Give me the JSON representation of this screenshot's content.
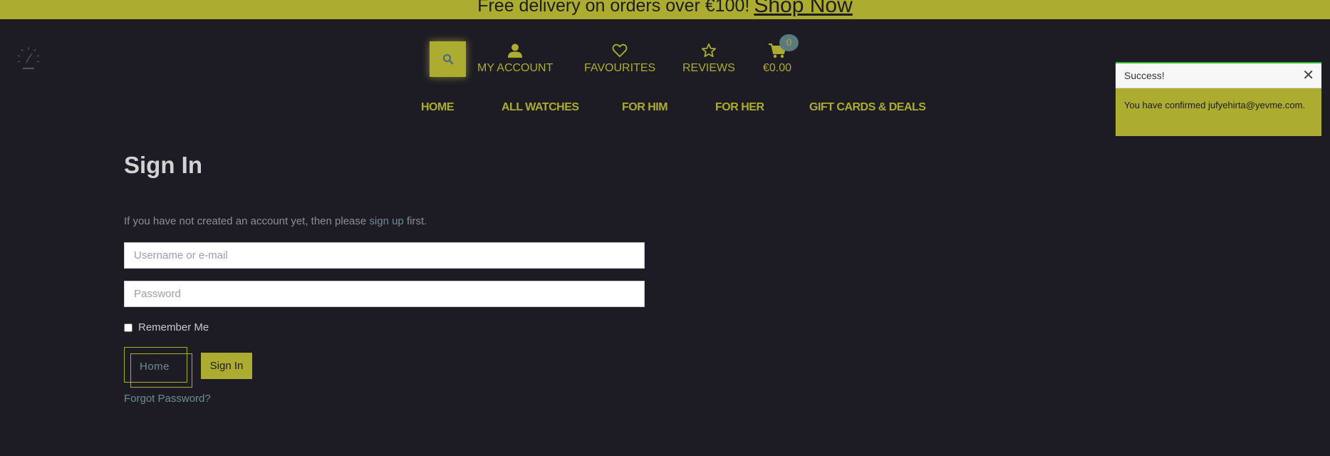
{
  "promo": {
    "text": "Free delivery on orders over €100!",
    "link": "Shop Now"
  },
  "header": {
    "account_label": "MY ACCOUNT",
    "favourites_label": "FAVOURITES",
    "reviews_label": "REVIEWS",
    "cart_total": "€0.00",
    "cart_count": "0",
    "icons": {
      "search": "search-icon",
      "account": "user-icon",
      "favourites": "heart-icon",
      "reviews": "star-icon",
      "cart": "cart-icon"
    }
  },
  "nav": {
    "home": "HOME",
    "all_watches": "ALL WATCHES",
    "for_him": "FOR HIM",
    "for_her": "FOR HER",
    "gift_cards": "GIFT CARDS & DEALS"
  },
  "signin": {
    "title": "Sign In",
    "intro_before": "If you have not created an account yet, then please ",
    "intro_link": "sign up",
    "intro_after": " first.",
    "username_placeholder": "Username or e-mail",
    "password_placeholder": "Password",
    "remember_label": "Remember Me",
    "home_button": "Home",
    "signin_button": "Sign In",
    "forgot_link": "Forgot Password?"
  },
  "toast": {
    "title": "Success!",
    "close": "✕",
    "message": "You have confirmed jufyehirta@yevme.com."
  },
  "colors": {
    "background": "#1d1c25",
    "accent": "#acac30",
    "link": "#6e8c95",
    "toast_border": "#2fb52f"
  }
}
